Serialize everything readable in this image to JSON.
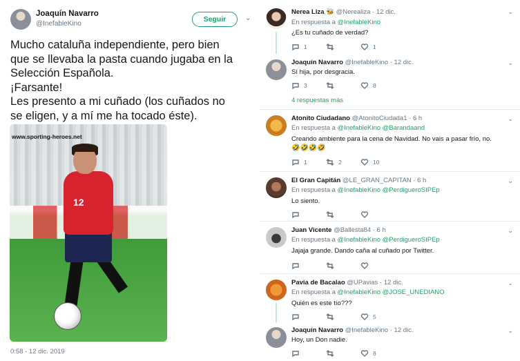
{
  "main": {
    "name": "Joaquín Navarro",
    "handle": "@InefableKino",
    "follow_label": "Seguir",
    "text_lines": [
      "Mucho cataluña independiente, pero bien",
      "que se llevaba la pasta cuando jugaba en la",
      "Selección Española.",
      "¡Farsante!",
      "Les presento a mi cuñado (los cuñados no",
      "se eligen, y a mí me ha tocado éste)."
    ],
    "photo_watermark": "www.sporting-heroes.net",
    "photo_number": "12",
    "timestamp": "0:58 - 12 dic. 2019"
  },
  "replies": [
    {
      "name": "Nerea Liza",
      "name_emoji": "🐝",
      "handle": "@Nerealiza",
      "time": "12 dic.",
      "reply_to_label": "En respuesta a",
      "reply_to": [
        "@InefableKino"
      ],
      "text": "¿Es tu cuñado de verdad?",
      "counts": {
        "reply": "1",
        "retweet": "",
        "like": "1"
      }
    },
    {
      "name": "Joaquín Navarro",
      "handle": "@InefableKino",
      "time": "12 dic.",
      "text": "Sí hija, por desgracia.",
      "counts": {
        "reply": "3",
        "retweet": "",
        "like": "8"
      },
      "more": "4 respuestas más"
    },
    {
      "name": "Atonito Ciudadano",
      "handle": "@AtonitoCiudada1",
      "time": "6 h",
      "reply_to_label": "En respuesta a",
      "reply_to": [
        "@InefableKino",
        "@Barandaand"
      ],
      "text": "Creando ambiente para la cena de Navidad. No vais a pasar frío, no.",
      "emoji": "🤣🤣🤣🤣",
      "counts": {
        "reply": "1",
        "retweet": "2",
        "like": "10"
      }
    },
    {
      "name": "El Gran Capitán",
      "handle": "@LE_GRAN_CAPITAN",
      "time": "6 h",
      "reply_to_label": "En respuesta a",
      "reply_to": [
        "@InefableKino",
        "@PerdigueroSIPEp"
      ],
      "text": "Lo siento.",
      "counts": {
        "reply": "",
        "retweet": "",
        "like": ""
      }
    },
    {
      "name": "Juan Vicente",
      "handle": "@Ballesta84",
      "time": "6 h",
      "reply_to_label": "En respuesta a",
      "reply_to": [
        "@InefableKino",
        "@PerdigueroSIPEp"
      ],
      "text": "Jajaja grande. Dando caña al cuñado por Twitter.",
      "counts": {
        "reply": "",
        "retweet": "",
        "like": ""
      }
    },
    {
      "name": "Pavia de Bacalao",
      "handle": "@UPavias",
      "time": "12 dic.",
      "reply_to_label": "En respuesta a",
      "reply_to": [
        "@InefableKino",
        "@JOSE_UNEDIANO"
      ],
      "text": "Quién es este tío???",
      "counts": {
        "reply": "",
        "retweet": "",
        "like": "5"
      }
    },
    {
      "name": "Joaquín Navarro",
      "handle": "@InefableKino",
      "time": "12 dic.",
      "text": "Hoy, un Don nadie.",
      "counts": {
        "reply": "",
        "retweet": "",
        "like": "8"
      }
    }
  ],
  "colors": {
    "accent": "#1ca566",
    "muted": "#657786",
    "text": "#14171a",
    "thread": "#c8e8d6"
  },
  "icons": [
    "reply-icon",
    "retweet-icon",
    "like-icon",
    "chevron-down-icon"
  ]
}
